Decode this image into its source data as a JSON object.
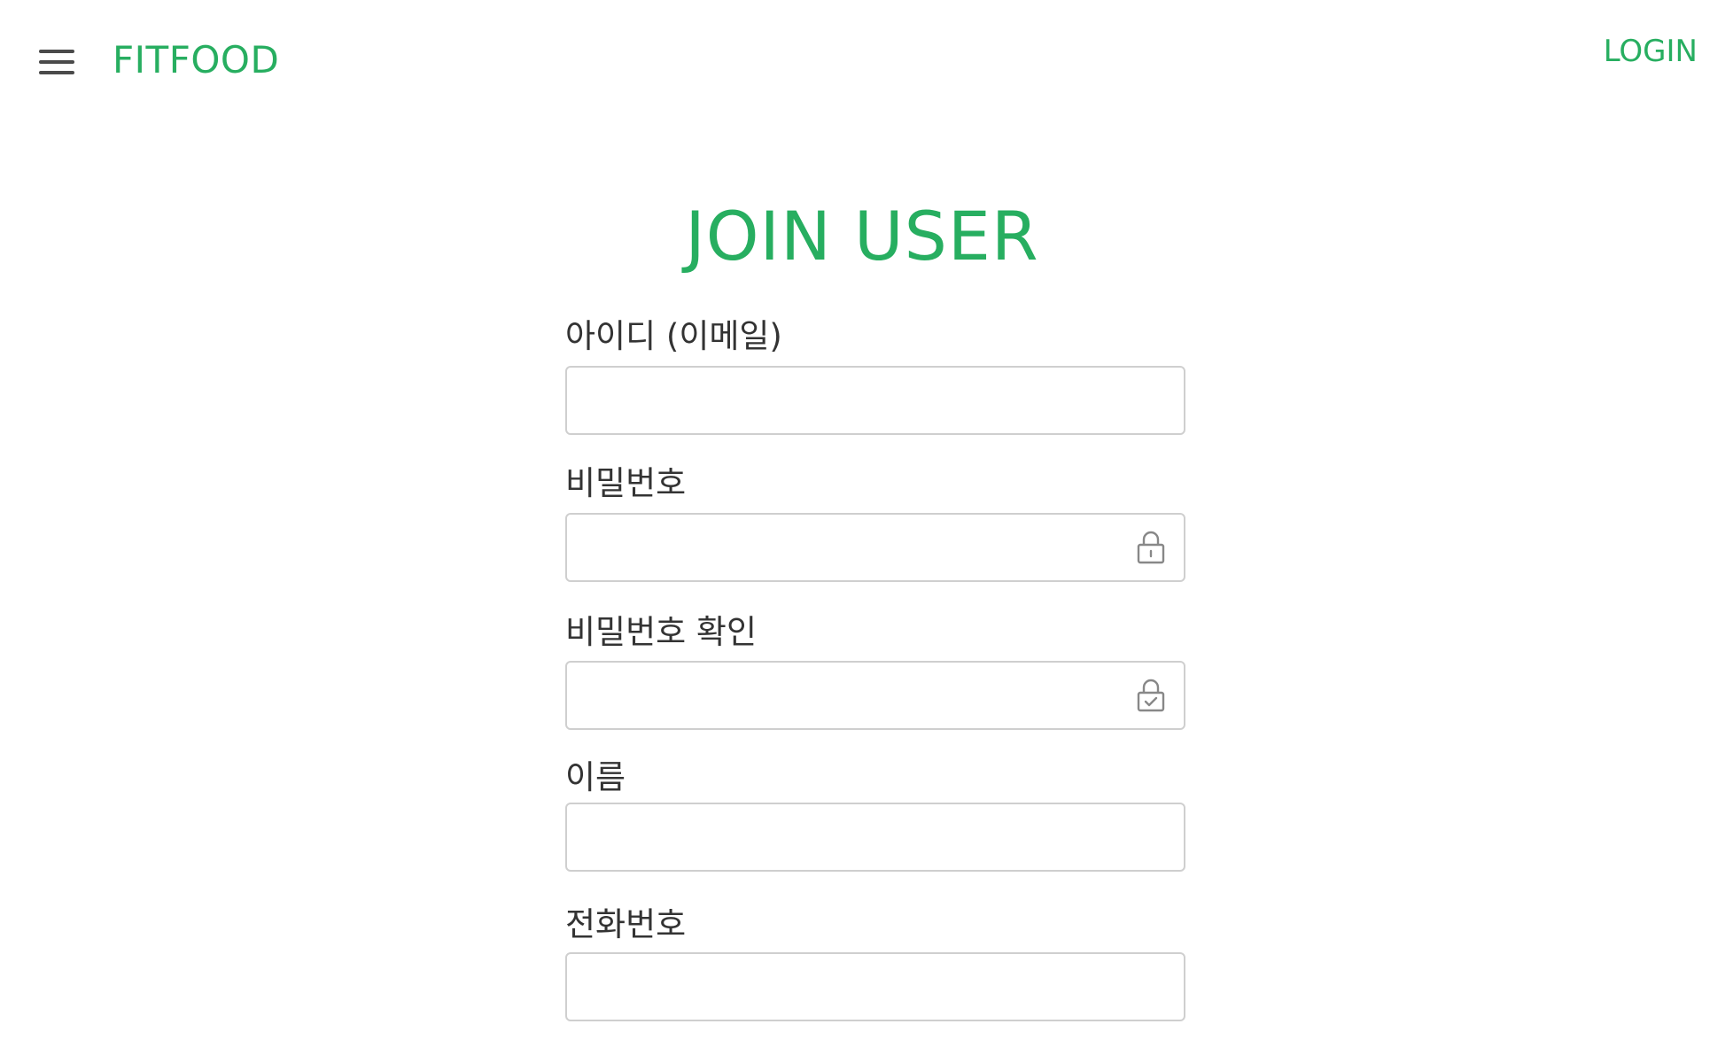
{
  "header": {
    "brand": "FITFOOD",
    "login_label": "LOGIN",
    "menu_icon": "hamburger-menu-icon",
    "accent_color": "#27ae60"
  },
  "page": {
    "title": "JOIN USER"
  },
  "form": {
    "email": {
      "label": "아이디 (이메일)",
      "value": "",
      "placeholder": ""
    },
    "password": {
      "label": "비밀번호",
      "value": "",
      "placeholder": "",
      "icon": "lock-icon"
    },
    "password_confirm": {
      "label": "비밀번호 확인",
      "value": "",
      "placeholder": "",
      "icon": "lock-check-icon"
    },
    "name": {
      "label": "이름",
      "value": "",
      "placeholder": ""
    },
    "phone": {
      "label": "전화번호",
      "value": "",
      "placeholder": ""
    }
  }
}
